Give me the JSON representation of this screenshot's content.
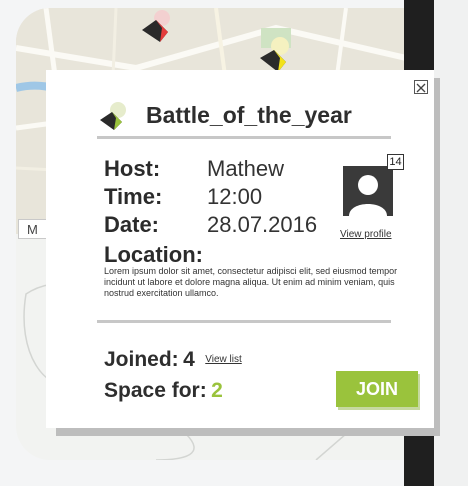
{
  "event": {
    "title": "Battle_of_the_year",
    "host_label": "Host:",
    "host": "Mathew",
    "time_label": "Time:",
    "time": "12:00",
    "date_label": "Date:",
    "date": "28.07.2016",
    "location_label": "Location:",
    "location_text": "Lorem ipsum dolor sit amet, consectetur adipisci elit, sed eiusmod tempor incidunt ut labore et dolore magna aliqua. Ut enim ad minim veniam, quis nostrud exercitation ullamco."
  },
  "host_profile": {
    "badge_count": "14",
    "view_profile": "View profile"
  },
  "participation": {
    "joined_label": "Joined:",
    "joined_count": "4",
    "view_list": "View list",
    "space_label": "Space for:",
    "space_count": "2"
  },
  "actions": {
    "join": "JOIN",
    "close_icon": "close-icon"
  },
  "map": {
    "tab_label": "M"
  },
  "colors": {
    "accent_green": "#9ac33c",
    "pin_red": "#e43c3c",
    "pin_yellow": "#f2e21a",
    "dark": "#2e2e2e"
  }
}
